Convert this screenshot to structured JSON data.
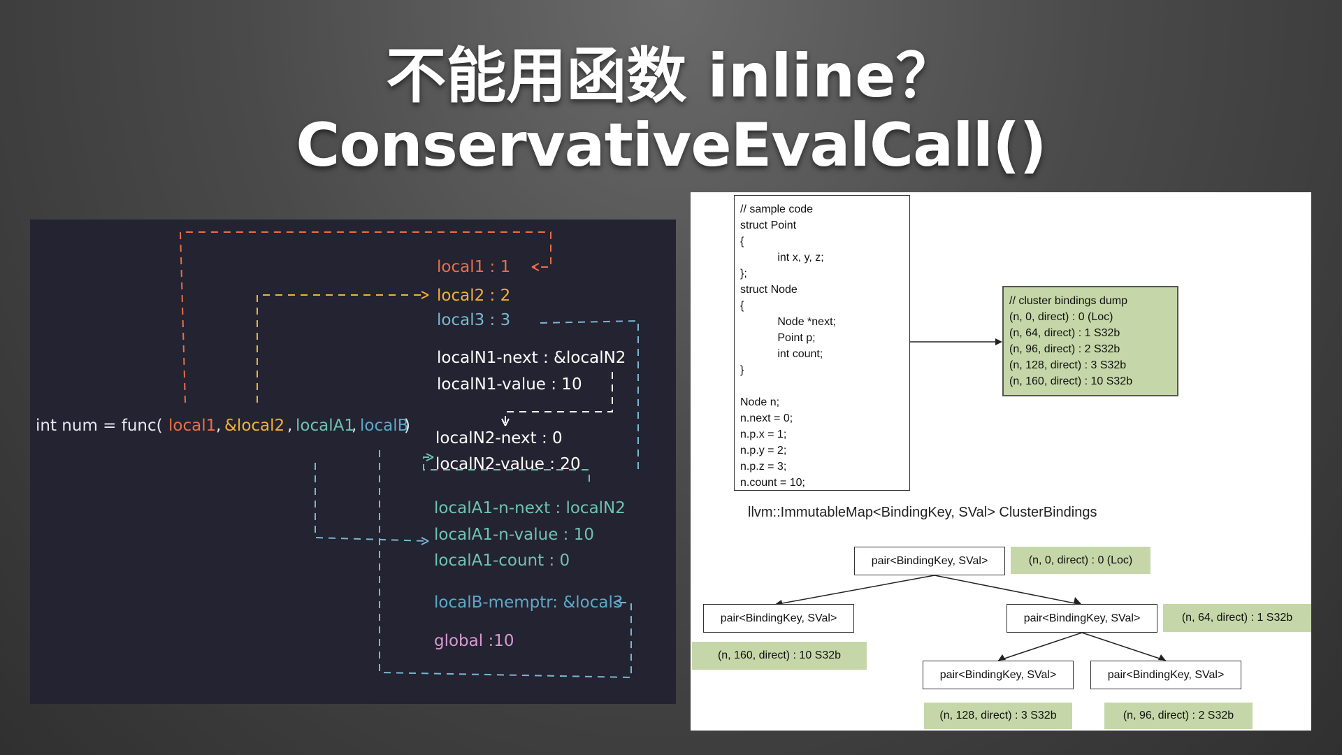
{
  "slide": {
    "title_line1": "不能用函数 inline？",
    "title_line2": "ConservativeEvalCall()"
  },
  "left_diagram": {
    "call_expr": "int num = func(",
    "args": [
      "local1",
      ",",
      "&local2",
      ",",
      "localA1",
      ",",
      "localB",
      ")"
    ],
    "entries": [
      {
        "label": "local1 :  1",
        "color": "#e8704a"
      },
      {
        "label": "local2 :  2",
        "color": "#f0b13e"
      },
      {
        "label": "local3 :  3",
        "color": "#7ab8cf"
      },
      {
        "label": "localN1-next : &localN2",
        "color": "#ffffff"
      },
      {
        "label": "localN1-value : 10",
        "color": "#ffffff"
      },
      {
        "label": "localN2-next : 0",
        "color": "#ffffff"
      },
      {
        "label": "localN2-value : 20",
        "color": "#ffffff"
      },
      {
        "label": "localA1-n-next : localN2",
        "color": "#6fc3b0"
      },
      {
        "label": "localA1-n-value : 10",
        "color": "#6fc3b0"
      },
      {
        "label": "localA1-count : 0",
        "color": "#6fc3b0"
      },
      {
        "label": "localB-memptr: &local3",
        "color": "#5fa8c8"
      },
      {
        "label": "global :10",
        "color": "#d69bd0"
      }
    ]
  },
  "right_diagram": {
    "code_lines": [
      "// sample code",
      "struct Point",
      "{",
      "            int x, y, z;",
      "};",
      "struct Node",
      "{",
      "            Node *next;",
      "            Point p;",
      "            int count;",
      "}",
      "",
      "Node n;",
      "n.next = 0;",
      "n.p.x = 1;",
      "n.p.y = 2;",
      "n.p.z = 3;",
      "n.count = 10;"
    ],
    "dump_lines": [
      "// cluster bindings dump",
      "(n, 0, direct) : 0 (Loc)",
      "(n, 64, direct) : 1 S32b",
      "(n, 96, direct) : 2 S32b",
      "(n, 128, direct) : 3 S32b",
      "(n, 160, direct) : 10 S32b"
    ],
    "map_label": "llvm::ImmutableMap<BindingKey, SVal> ClusterBindings",
    "pair_label": "pair<BindingKey, SVal>",
    "values": {
      "root": "(n, 0, direct) : 0 (Loc)",
      "right": "(n, 64, direct) : 1 S32b",
      "left": "(n, 160, direct) : 10 S32b",
      "rl": "(n, 128, direct) : 3 S32b",
      "rr": "(n, 96, direct) : 2 S32b"
    }
  },
  "colors": {
    "red": "#e8704a",
    "yellow": "#f0b13e",
    "teal": "#6fc3b0",
    "blue": "#5fa8c8",
    "white": "#ffffff",
    "pink": "#d69bd0",
    "green_box": "#c5d7a8"
  }
}
